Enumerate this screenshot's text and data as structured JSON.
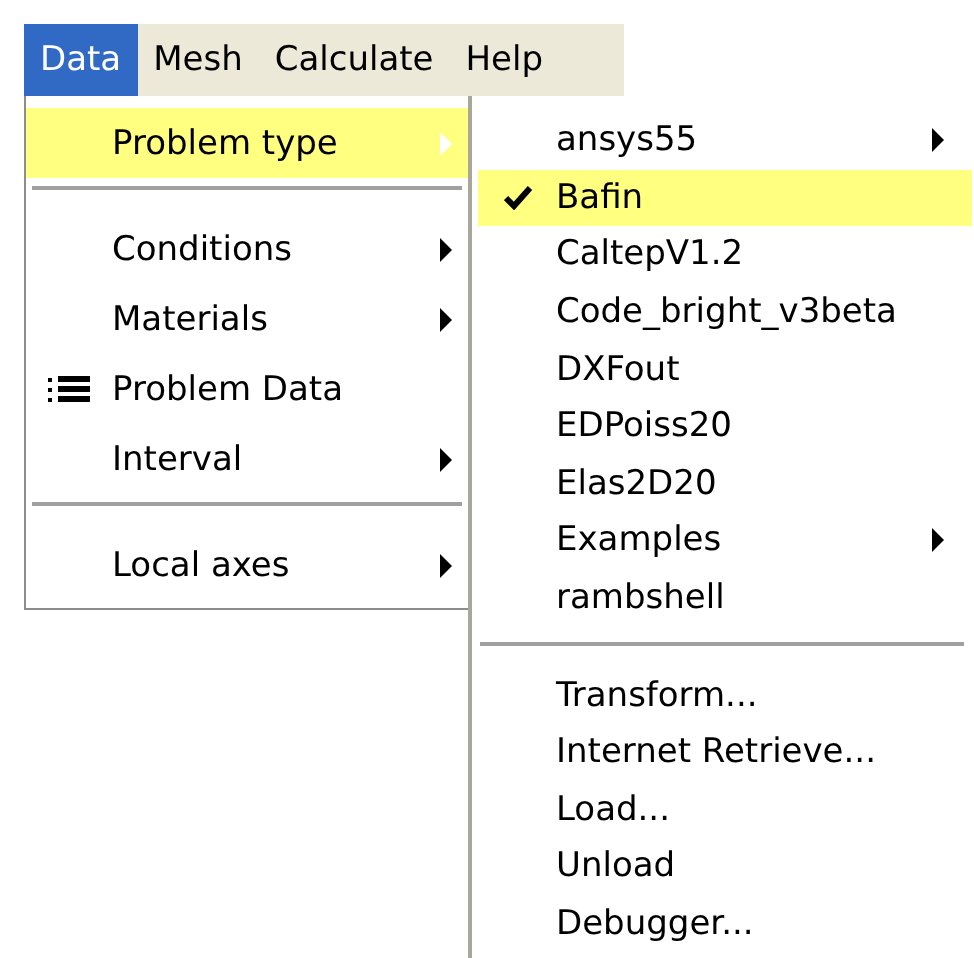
{
  "menubar": [
    {
      "label": "Data",
      "selected": true
    },
    {
      "label": "Mesh",
      "selected": false
    },
    {
      "label": "Calculate",
      "selected": false
    },
    {
      "label": "Help",
      "selected": false
    }
  ],
  "menu": [
    {
      "kind": "item",
      "label": "Problem type",
      "submenu": true,
      "highlighted": true,
      "has_icon": false
    },
    {
      "kind": "separator"
    },
    {
      "kind": "item",
      "label": "Conditions",
      "submenu": true,
      "highlighted": false,
      "has_icon": false
    },
    {
      "kind": "item",
      "label": "Materials",
      "submenu": true,
      "highlighted": false,
      "has_icon": false
    },
    {
      "kind": "item",
      "label": "Problem Data",
      "submenu": false,
      "highlighted": false,
      "has_icon": true
    },
    {
      "kind": "item",
      "label": "Interval",
      "submenu": true,
      "highlighted": false,
      "has_icon": false
    },
    {
      "kind": "separator"
    },
    {
      "kind": "item",
      "label": "Local axes",
      "submenu": true,
      "highlighted": false,
      "has_icon": false
    }
  ],
  "submenu": [
    {
      "kind": "item",
      "label": "ansys55",
      "submenu": true,
      "checked": false,
      "highlighted": false
    },
    {
      "kind": "item",
      "label": "Bafin",
      "submenu": false,
      "checked": true,
      "highlighted": true
    },
    {
      "kind": "item",
      "label": "CaltepV1.2",
      "submenu": false,
      "checked": false,
      "highlighted": false
    },
    {
      "kind": "item",
      "label": "Code_bright_v3beta",
      "submenu": false,
      "checked": false,
      "highlighted": false
    },
    {
      "kind": "item",
      "label": "DXFout",
      "submenu": false,
      "checked": false,
      "highlighted": false
    },
    {
      "kind": "item",
      "label": "EDPoiss20",
      "submenu": false,
      "checked": false,
      "highlighted": false
    },
    {
      "kind": "item",
      "label": "Elas2D20",
      "submenu": false,
      "checked": false,
      "highlighted": false
    },
    {
      "kind": "item",
      "label": "Examples",
      "submenu": true,
      "checked": false,
      "highlighted": false
    },
    {
      "kind": "item",
      "label": "rambshell",
      "submenu": false,
      "checked": false,
      "highlighted": false
    },
    {
      "kind": "separator"
    },
    {
      "kind": "item",
      "label": "Transform...",
      "submenu": false,
      "checked": false,
      "highlighted": false
    },
    {
      "kind": "item",
      "label": "Internet Retrieve...",
      "submenu": false,
      "checked": false,
      "highlighted": false
    },
    {
      "kind": "item",
      "label": "Load...",
      "submenu": false,
      "checked": false,
      "highlighted": false
    },
    {
      "kind": "item",
      "label": "Unload",
      "submenu": false,
      "checked": false,
      "highlighted": false
    },
    {
      "kind": "item",
      "label": "Debugger...",
      "submenu": false,
      "checked": false,
      "highlighted": false
    }
  ]
}
